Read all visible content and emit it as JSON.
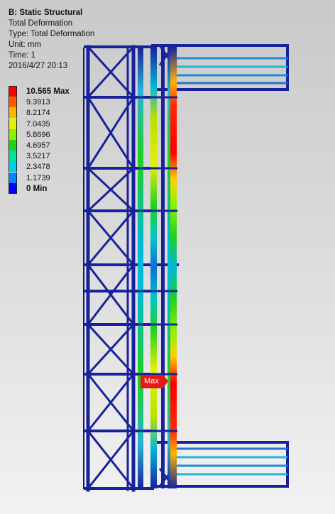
{
  "info": {
    "title": "B: Static Structural",
    "result": "Total Deformation",
    "type": "Type: Total Deformation",
    "unit": "Unit: mm",
    "time": "Time: 1",
    "date": "2016/4/27 20:13"
  },
  "legend": [
    {
      "label": "10.565 Max",
      "color": "#ff0000",
      "bold": true
    },
    {
      "label": "9.3913",
      "color": "#ff5a00"
    },
    {
      "label": "8.2174",
      "color": "#ffb400"
    },
    {
      "label": "7.0435",
      "color": "#e6f000"
    },
    {
      "label": "5.8696",
      "color": "#8cf000"
    },
    {
      "label": "4.6957",
      "color": "#1ed21e"
    },
    {
      "label": "3.5217",
      "color": "#00e6a0"
    },
    {
      "label": "2.3478",
      "color": "#00d2e6"
    },
    {
      "label": "1.1739",
      "color": "#0087ff"
    },
    {
      "label": "0 Min",
      "color": "#0000ff",
      "bold": true
    }
  ],
  "max_marker": {
    "label": "Max",
    "color": "#e31b14"
  },
  "colors": {
    "frame": "#17229b",
    "frame_dark": "#0e1775"
  }
}
